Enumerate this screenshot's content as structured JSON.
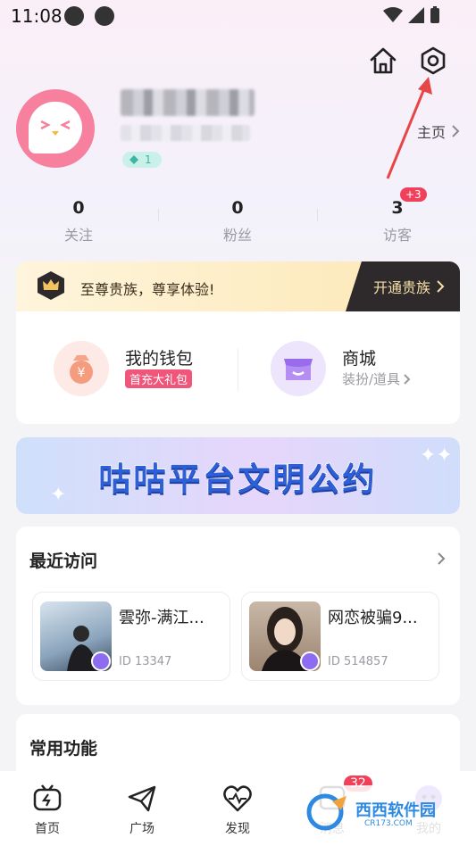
{
  "status_bar": {
    "time": "11:08"
  },
  "profile": {
    "homepage_label": "主页",
    "level": "1"
  },
  "stats": [
    {
      "value": "0",
      "label": "关注"
    },
    {
      "value": "0",
      "label": "粉丝"
    },
    {
      "value": "3",
      "label": "访客",
      "badge": "+3"
    }
  ],
  "noble": {
    "text": "至尊贵族，尊享体验!",
    "button": "开通贵族"
  },
  "wallet": {
    "title": "我的钱包",
    "tag": "首充大礼包"
  },
  "shop": {
    "title": "商城",
    "subtitle": "装扮/道具"
  },
  "banner": {
    "text": "咕咕平台文明公约"
  },
  "recent": {
    "title": "最近访问",
    "items": [
      {
        "name": "雲弥-满江...",
        "id": "ID 13347"
      },
      {
        "name": "网恋被骗9...",
        "id": "ID 514857"
      }
    ]
  },
  "functions": {
    "title": "常用功能"
  },
  "tabs": [
    {
      "label": "首页"
    },
    {
      "label": "广场"
    },
    {
      "label": "发现"
    },
    {
      "label": "消息",
      "badge": "32"
    },
    {
      "label": "我的"
    }
  ],
  "watermark": {
    "text": "西西软件园",
    "sub": "CR173.COM"
  },
  "colors": {
    "accent": "#f0405a",
    "avatar": "#f6809e",
    "banner_text": "#2f5fd7",
    "noble_btn": "#2e2a2c"
  }
}
